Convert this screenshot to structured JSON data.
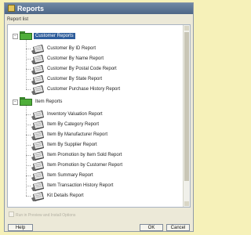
{
  "window": {
    "title": "Reports",
    "subheader": "Report list"
  },
  "tree": {
    "groups": [
      {
        "label": "Customer Reports",
        "selected": true,
        "items": [
          "Customer By ID Report",
          "Customer By Name Report",
          "Customer By Postal Code Report",
          "Customer By State Report",
          "Customer Purchase History Report"
        ]
      },
      {
        "label": "Item Reports",
        "selected": false,
        "items": [
          "Inventory Valuation Report",
          "Item By Category Report",
          "Item By Manufacturer Report",
          "Item By Supplier Report",
          "Item Promotion by Item Sold Report",
          "Item Promotion by Customer Report",
          "Item Summary Report",
          "Item Transaction History Report",
          "Kit Details Report"
        ]
      }
    ]
  },
  "footer": {
    "checkbox_label": "Run in Preview and Install Options",
    "help_label": "Help",
    "ok_label": "OK",
    "cancel_label": "Cancel"
  },
  "colors": {
    "background": "#f6f1b9",
    "titlebar": "#4d6686",
    "selection": "#2f5e9c",
    "folder": "#4fae3a"
  },
  "icons": {
    "group": "folder-icon",
    "item": "report-icon"
  }
}
